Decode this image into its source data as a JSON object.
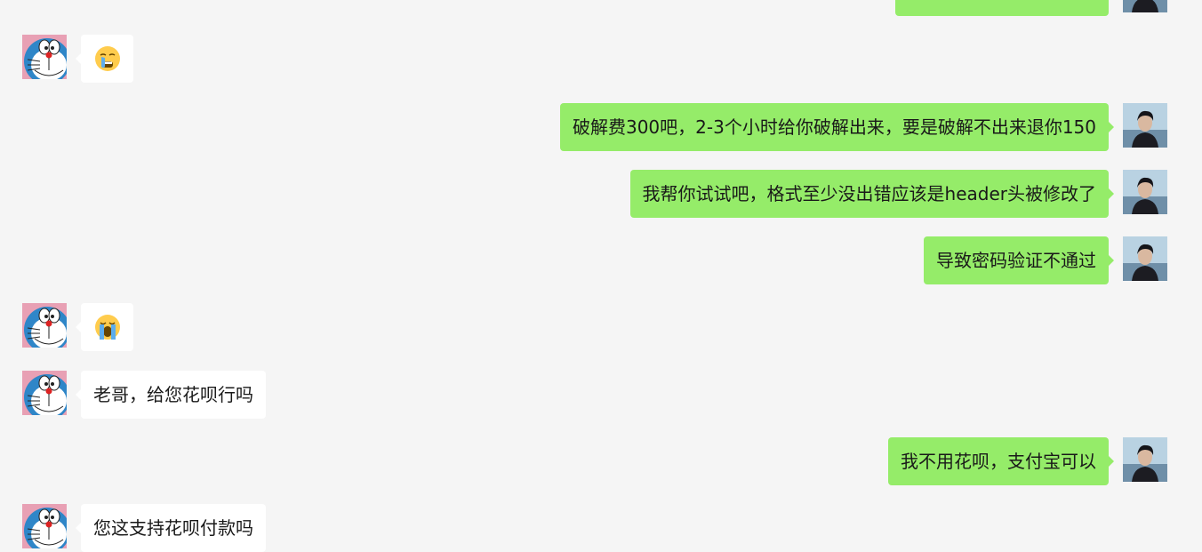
{
  "colors": {
    "background": "#f5f5f5",
    "incoming_bubble": "#ffffff",
    "outgoing_bubble": "#95ec69",
    "text": "#191919"
  },
  "avatars": {
    "contact": "doraemon-avatar",
    "self": "person-photo-avatar"
  },
  "messages": [
    {
      "direction": "out",
      "type": "text",
      "text": ""
    },
    {
      "direction": "in",
      "type": "emoji",
      "emoji": "crying-face-emoji"
    },
    {
      "direction": "out",
      "type": "text",
      "text": "破解费300吧，2-3个小时给你破解出来，要是破解不出来退你150"
    },
    {
      "direction": "out",
      "type": "text",
      "text": "我帮你试试吧，格式至少没出错应该是header头被修改了"
    },
    {
      "direction": "out",
      "type": "text",
      "text": "导致密码验证不通过"
    },
    {
      "direction": "in",
      "type": "emoji",
      "emoji": "loudly-crying-face-emoji"
    },
    {
      "direction": "in",
      "type": "text",
      "text": "老哥，给您花呗行吗"
    },
    {
      "direction": "out",
      "type": "text",
      "text": "我不用花呗，支付宝可以"
    },
    {
      "direction": "in",
      "type": "text",
      "text": "您这支持花呗付款吗"
    }
  ]
}
